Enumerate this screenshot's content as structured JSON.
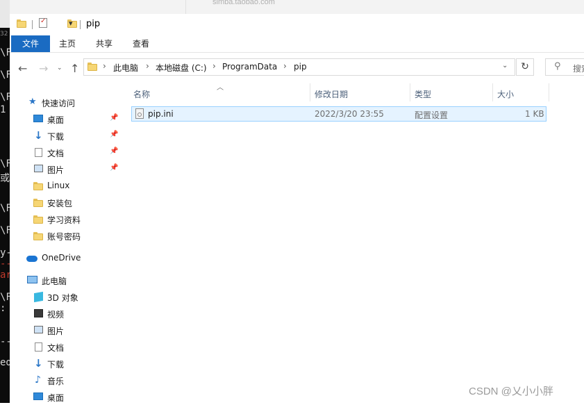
{
  "background": {
    "browser_url": "simba.taobao.com",
    "terminal_lines": [
      "32",
      "\\F",
      "\\F",
      "\\F",
      "1",
      "",
      "",
      "",
      "\\F",
      "或",
      "\\F",
      "\\F",
      "y-",
      "--",
      "ar",
      "\\F",
      ":",
      "",
      "",
      "--",
      "ed"
    ]
  },
  "window": {
    "title": "pip",
    "quick_access_dropdown": "▾"
  },
  "ribbon": {
    "tabs": [
      "文件",
      "主页",
      "共享",
      "查看"
    ]
  },
  "address": {
    "crumbs": [
      "此电脑",
      "本地磁盘 (C:)",
      "ProgramData",
      "pip"
    ],
    "search_placeholder": "搜索"
  },
  "nav": {
    "quick_access": "快速访问",
    "pinned": [
      "桌面",
      "下载",
      "文档",
      "图片"
    ],
    "folders": [
      "Linux",
      "安装包",
      "学习资料",
      "账号密码"
    ],
    "onedrive": "OneDrive",
    "this_pc": "此电脑",
    "pc_items": [
      "3D 对象",
      "视频",
      "图片",
      "文档",
      "下载",
      "音乐",
      "桌面"
    ]
  },
  "columns": [
    "名称",
    "修改日期",
    "类型",
    "大小"
  ],
  "files": [
    {
      "name": "pip.ini",
      "modified": "2022/3/20 23:55",
      "type": "配置设置",
      "size": "1 KB"
    }
  ],
  "watermark": "CSDN @乂小小胖",
  "colors": {
    "accent": "#1a6bc2",
    "selection": "#e5f3ff",
    "selection_border": "#99d1ff",
    "folder": "#f6d675"
  }
}
